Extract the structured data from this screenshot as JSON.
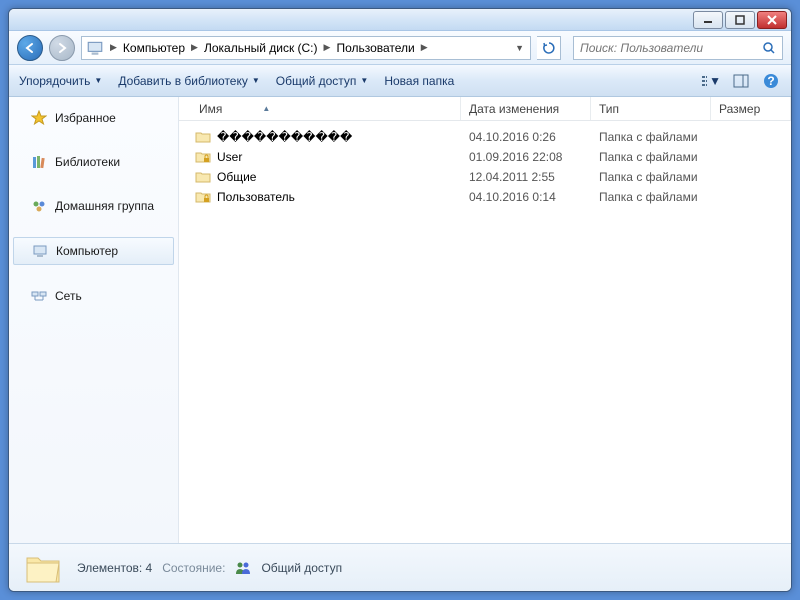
{
  "breadcrumb": {
    "seg1": "Компьютер",
    "seg2": "Локальный диск (C:)",
    "seg3": "Пользователи"
  },
  "search": {
    "placeholder": "Поиск: Пользователи"
  },
  "toolbar": {
    "organize": "Упорядочить",
    "library": "Добавить в библиотеку",
    "share": "Общий доступ",
    "newfolder": "Новая папка"
  },
  "sidebar": {
    "favorites": "Избранное",
    "libraries": "Библиотеки",
    "homegroup": "Домашняя группа",
    "computer": "Компьютер",
    "network": "Сеть"
  },
  "columns": {
    "name": "Имя",
    "date": "Дата изменения",
    "type": "Тип",
    "size": "Размер"
  },
  "files": {
    "r0": {
      "name": "�����������",
      "date": "04.10.2016 0:26",
      "type": "Папка с файлами"
    },
    "r1": {
      "name": "User",
      "date": "01.09.2016 22:08",
      "type": "Папка с файлами"
    },
    "r2": {
      "name": "Общие",
      "date": "12.04.2011 2:55",
      "type": "Папка с файлами"
    },
    "r3": {
      "name": "Пользователь",
      "date": "04.10.2016 0:14",
      "type": "Папка с файлами"
    }
  },
  "status": {
    "count_label": "Элементов: 4",
    "state_label": "Состояние:",
    "shared": "Общий доступ"
  }
}
